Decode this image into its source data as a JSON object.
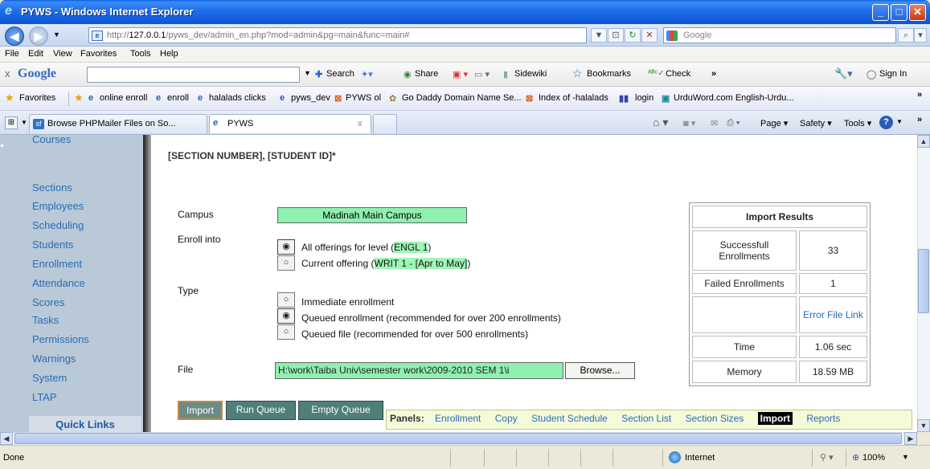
{
  "window": {
    "title": "PYWS - Windows Internet Explorer"
  },
  "address": {
    "url_prefix": "http://",
    "url_host": "127.0.0.1",
    "url_rest": "/pyws_dev/admin_en.php?mod=admin&pg=main&func=main#",
    "search_placeholder": "Google"
  },
  "menu": {
    "items": [
      "File",
      "Edit",
      "View",
      "Favorites",
      "Tools",
      "Help"
    ]
  },
  "google_toolbar": {
    "brand": "Google",
    "close": "x",
    "search": "Search",
    "share": "Share",
    "sidewiki": "Sidewiki",
    "bookmarks": "Bookmarks",
    "check": "Check",
    "more": "»",
    "signin": "Sign In"
  },
  "favorites": {
    "label": "Favorites",
    "items": [
      "online enroll",
      "enroll",
      "halalads clicks",
      "pyws_dev",
      "PYWS ol",
      "Go Daddy Domain Name Se...",
      "Index of -halalads",
      "login",
      "UrduWord.com English-Urdu..."
    ]
  },
  "tabs": {
    "items": [
      "Browse PHPMailer Files on So...",
      "PYWS"
    ],
    "close": "x"
  },
  "command_bar": {
    "page": "Page",
    "safety": "Safety",
    "tools": "Tools"
  },
  "sidebar": {
    "items": [
      "Courses",
      "Sections",
      "Employees",
      "Scheduling",
      "Students",
      "Enrollment",
      "Attendance",
      "Scores",
      "Tasks",
      "Permissions",
      "Warnings",
      "System",
      "LTAP"
    ],
    "quick_links": "Quick Links"
  },
  "form": {
    "header": "[SECTION NUMBER],  [STUDENT ID]*",
    "campus_label": "Campus",
    "campus_value": "Madinah Main Campus",
    "enroll_label": "Enroll into",
    "enroll_opt1_prefix": "All offerings for level (",
    "enroll_opt1_hl": "ENGL 1",
    "enroll_opt1_suffix": ")",
    "enroll_opt2_prefix": "Current offering (",
    "enroll_opt2_hl": "WRIT 1 - [Apr to May]",
    "enroll_opt2_suffix": ")",
    "type_label": "Type",
    "type_opt1": "Immediate enrollment",
    "type_opt2": "Queued enrollment (recommended for over 200 enrollments)",
    "type_opt3": "Queued file (recommended for over 500 enrollments)",
    "file_label": "File",
    "file_value": "H:\\work\\Taiba Univ\\semester work\\2009-2010 SEM 1\\i",
    "browse": "Browse..."
  },
  "actions": {
    "import": "Import",
    "run_queue": "Run Queue",
    "empty_queue": "Empty Queue"
  },
  "results": {
    "title": "Import Results",
    "success_label": "Successfull Enrollments",
    "success_value": "33",
    "failed_label": "Failed Enrollments",
    "failed_value": "1",
    "error_link": "Error File Link",
    "time_label": "Time",
    "time_value": "1.06 sec",
    "memory_label": "Memory",
    "memory_value": "18.59 MB"
  },
  "panels": {
    "label": "Panels:",
    "items": [
      "Enrollment",
      "Copy",
      "Student Schedule",
      "Section List",
      "Section Sizes"
    ],
    "active": "Import",
    "after": "Reports"
  },
  "status": {
    "left": "Done",
    "zone": "Internet",
    "zoom": "100%"
  }
}
